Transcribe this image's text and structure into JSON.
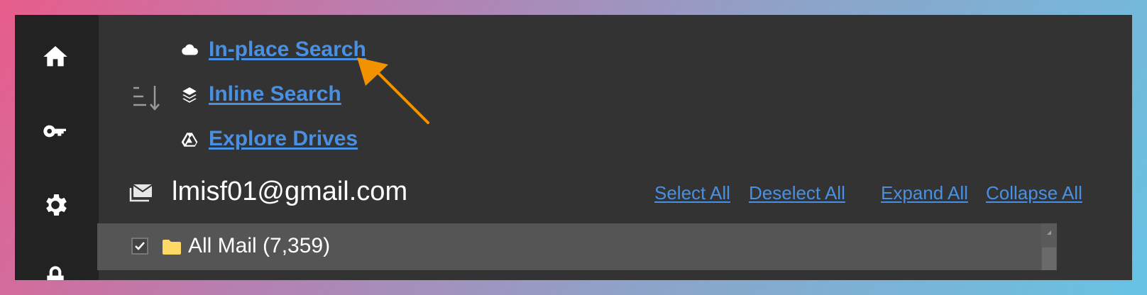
{
  "sidebar": {
    "items": [
      {
        "icon": "home-icon"
      },
      {
        "icon": "key-icon"
      },
      {
        "icon": "gear-icon"
      },
      {
        "icon": "lock-icon"
      }
    ]
  },
  "search_links": [
    {
      "label": "In-place Search",
      "icon": "cloud-icon"
    },
    {
      "label": "Inline Search",
      "icon": "layers-icon"
    },
    {
      "label": "Explore Drives",
      "icon": "drive-icon"
    }
  ],
  "account": {
    "email": "lmisf01@gmail.com",
    "icon": "mail-icon"
  },
  "actions": {
    "select_all": "Select All",
    "deselect_all": "Deselect All",
    "expand_all": "Expand All",
    "collapse_all": "Collapse All"
  },
  "tree": {
    "rows": [
      {
        "label": "All Mail (7,359)",
        "checked": true,
        "icon": "folder-icon"
      }
    ]
  },
  "colors": {
    "link": "#4a90e2",
    "background": "#333333",
    "sidebar": "#222222",
    "folder": "#ffd966",
    "arrow": "#f39200"
  }
}
